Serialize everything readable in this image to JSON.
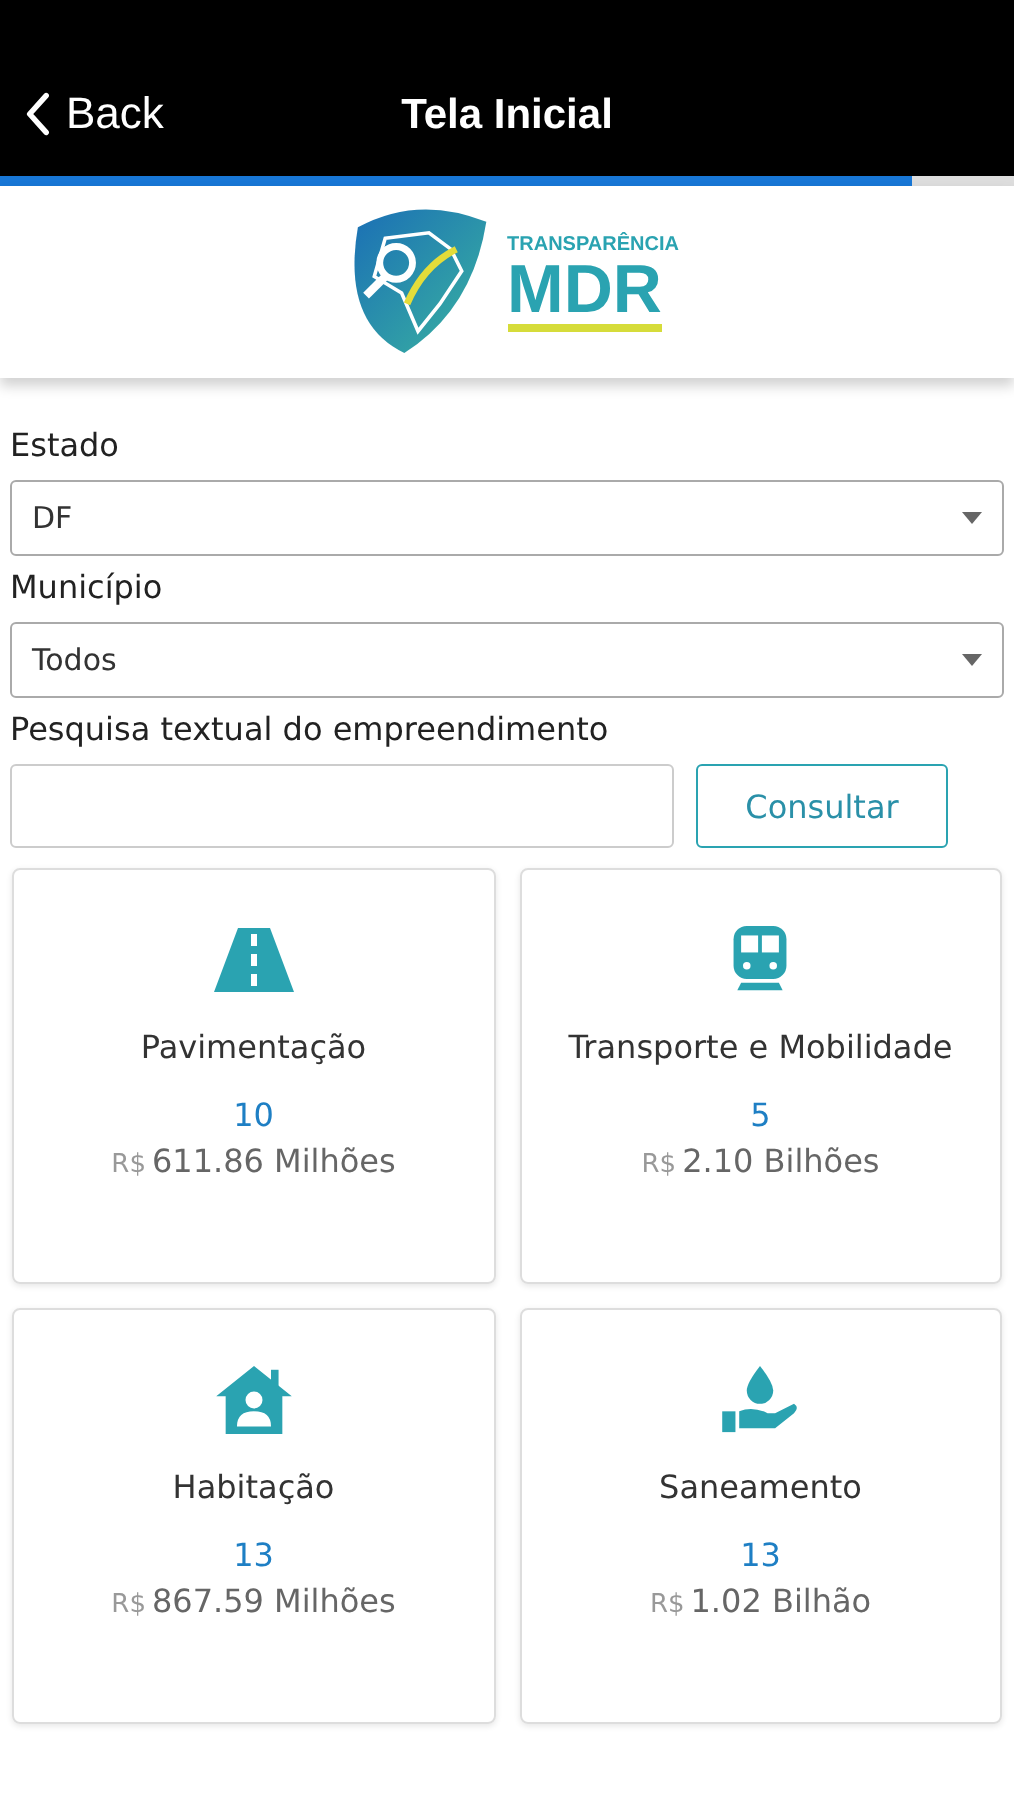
{
  "nav": {
    "back": "Back",
    "title": "Tela Inicial"
  },
  "progress": {
    "level": 0.9
  },
  "logo": {
    "small": "TRANSPARÊNCIA",
    "big": "MDR"
  },
  "filters": [
    {
      "label": "Estado",
      "value": "DF"
    },
    {
      "label": "Município",
      "value": "Todos"
    }
  ],
  "search": {
    "label": "Pesquisa textual do empreendimento",
    "button": "Consultar"
  },
  "cards": [
    {
      "kind": "road",
      "title": "Pavimentação",
      "count": "10",
      "currency": "R$",
      "amount": "611.86 Milhões"
    },
    {
      "kind": "train",
      "title": "Transporte e Mobilidade",
      "count": "5",
      "currency": "R$",
      "amount": "2.10 Bilhões"
    },
    {
      "kind": "house",
      "title": "Habitação",
      "count": "13",
      "currency": "R$",
      "amount": "867.59 Milhões"
    },
    {
      "kind": "water",
      "title": "Saneamento",
      "count": "13",
      "currency": "R$",
      "amount": "1.02 Bilhão"
    }
  ]
}
